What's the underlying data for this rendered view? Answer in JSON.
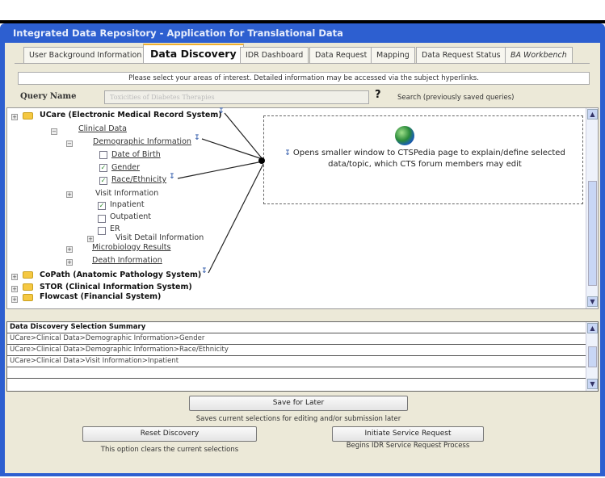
{
  "window": {
    "title": "Integrated Data Repository - Application for Translational Data",
    "colors": {
      "titlebar": "#2d5fd0",
      "client": "#ece9d8"
    }
  },
  "tabs": [
    {
      "label": "User Background Information",
      "active": false
    },
    {
      "label": "Data Discovery",
      "active": true
    },
    {
      "label": "IDR Dashboard",
      "active": false
    },
    {
      "label": "Data Request",
      "active": false
    },
    {
      "label": "Mapping",
      "active": false
    },
    {
      "label": "Data Request Status",
      "active": false
    },
    {
      "label": "BA Workbench",
      "active": false
    }
  ],
  "instructions": "Please select your areas of interest.  Detailed information may be accessed via the subject hyperlinks.",
  "query": {
    "label": "Query Name",
    "value": "Toxicities of Diabetes Therapies",
    "help": "?",
    "search": "Search (previously saved queries)"
  },
  "tree": {
    "ucare": "UCare (Electronic Medical Record System)",
    "clinical": "Clinical Data",
    "demographic": "Demographic Information",
    "dob": {
      "label": "Date of Birth",
      "checked": false
    },
    "gender": {
      "label": "Gender",
      "checked": true
    },
    "race": {
      "label": "Race/Ethnicity",
      "checked": true
    },
    "visit": "Visit Information",
    "inpatient": {
      "label": "Inpatient",
      "checked": true
    },
    "outpatient": {
      "label": "Outpatient",
      "checked": false
    },
    "er": {
      "label": "ER",
      "checked": false
    },
    "visit_detail": "Visit Detail Information",
    "micro": "Microbiology Results",
    "death": "Death Information",
    "copath": "CoPath (Anatomic Pathology System)",
    "stor": "STOR (Clinical Information System)",
    "flowcast": "Flowcast (Financial System)"
  },
  "callout": {
    "icon": "globe-icon",
    "text": "Opens smaller window to CTSPedia page to explain/define selected data/topic, which CTS forum members may edit"
  },
  "summary": {
    "header": "Data Discovery Selection Summary",
    "rows": [
      "UCare>Clinical Data>Demographic Information>Gender",
      "UCare>Clinical Data>Demographic Information>Race/Ethnicity",
      "UCare>Clinical Data>Visit Information>Inpatient",
      "",
      ""
    ]
  },
  "actions": {
    "save": "Save for Later",
    "save_caption": "Saves current selections for editing and/or submission later",
    "reset": "Reset Discovery",
    "reset_caption": "This option clears the current selections",
    "initiate": "Initiate Service Request",
    "initiate_caption": "Begins IDR Service Request Process"
  }
}
